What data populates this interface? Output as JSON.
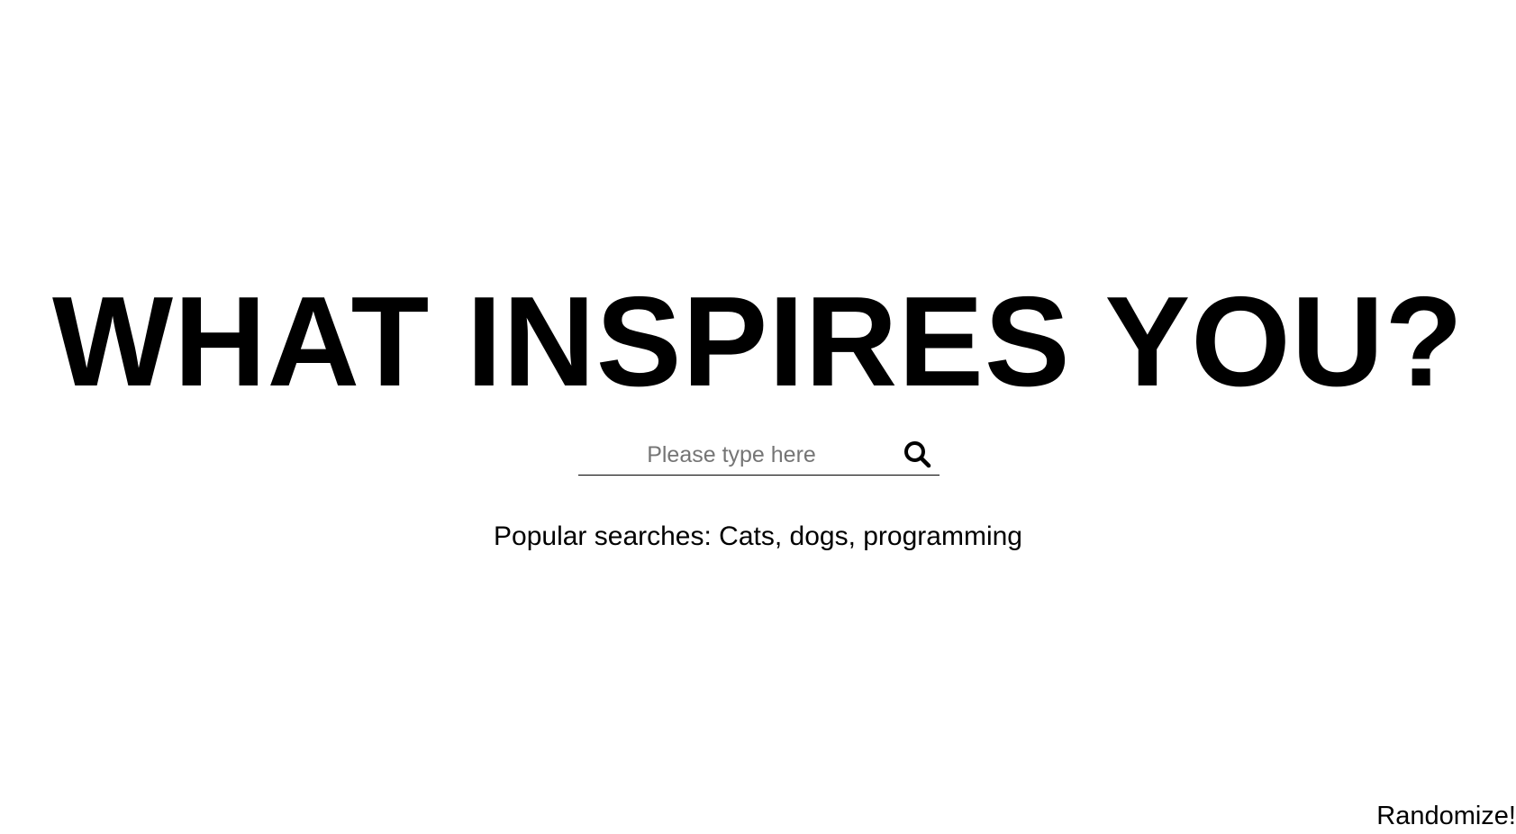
{
  "headline": "WHAT INSPIRES YOU?",
  "search": {
    "placeholder": "Please type here",
    "value": "",
    "icon": "search-icon"
  },
  "popular": {
    "label": "Popular searches: ",
    "items": [
      "Cats",
      "dogs",
      "programming"
    ],
    "separator": ", "
  },
  "randomize_label": "Randomize!",
  "colors": {
    "text": "#000000",
    "background": "#ffffff",
    "placeholder": "#757575"
  }
}
